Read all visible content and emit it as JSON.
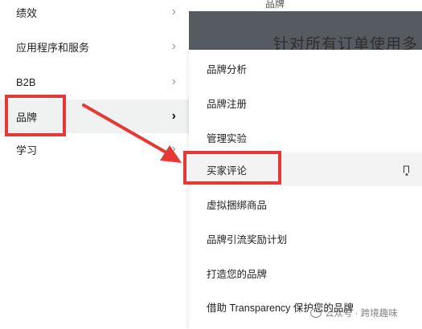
{
  "left_menu": {
    "items": [
      {
        "label": "绩效",
        "chevron": "›"
      },
      {
        "label": "应用程序和服务",
        "chevron": "›"
      },
      {
        "label": "B2B",
        "chevron": "›"
      },
      {
        "label": "品牌",
        "chevron": "›"
      },
      {
        "label": "学习",
        "chevron": "›"
      }
    ],
    "active_index": 3
  },
  "page": {
    "header": "品牌",
    "headline": "针对所有订单使用多"
  },
  "submenu": {
    "items": [
      {
        "label": "品牌分析"
      },
      {
        "label": "品牌注册"
      },
      {
        "label": "管理实验"
      },
      {
        "label": "买家评论",
        "icon": "bookmark-icon"
      },
      {
        "label": "虚拟捆绑商品"
      },
      {
        "label": "品牌引流奖励计划"
      },
      {
        "label": "打造您的品牌"
      },
      {
        "label": "借助 Transparency 保护您的品牌"
      }
    ],
    "highlighted_index": 3
  },
  "annotations": {
    "color": "#e53935"
  },
  "watermark": {
    "text": "公众号 · 跨境趣味"
  }
}
